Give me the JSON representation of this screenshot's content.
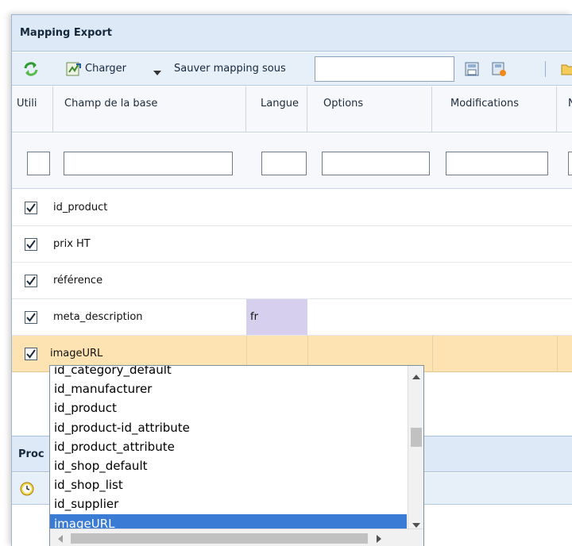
{
  "panel": {
    "title": "Mapping Export"
  },
  "toolbar": {
    "load_label": "Charger",
    "save_as_label": "Sauver mapping sous",
    "save_as_value": ""
  },
  "columns": [
    {
      "label": "Utili"
    },
    {
      "label": "Champ de la base"
    },
    {
      "label": "Langue"
    },
    {
      "label": "Options"
    },
    {
      "label": "Modifications"
    },
    {
      "label": "N"
    }
  ],
  "rows": [
    {
      "checked": true,
      "field": "id_product",
      "lang": ""
    },
    {
      "checked": true,
      "field": "prix HT",
      "lang": ""
    },
    {
      "checked": true,
      "field": "référence",
      "lang": ""
    },
    {
      "checked": true,
      "field": "meta_description",
      "lang": "fr"
    },
    {
      "checked": true,
      "field": "imageURL",
      "lang": "",
      "selected": true
    }
  ],
  "second_panel": {
    "title": "Proc"
  },
  "dropdown": {
    "items": [
      "id_category_default",
      "id_manufacturer",
      "id_product",
      "id_product-id_attribute",
      "id_product_attribute",
      "id_shop_default",
      "id_shop_list",
      "id_supplier",
      "imageURL"
    ],
    "selected": "imageURL"
  },
  "colors": {
    "selected_row": "#fde3b1",
    "lang_cell": "#d6d0ee",
    "dropdown_highlight": "#3a7bd5",
    "header_bg": "#dde9f7"
  },
  "icons": [
    "refresh-icon",
    "import-icon",
    "chevron-down-icon",
    "save-icon",
    "save-as-icon",
    "folder-icon",
    "clock-icon"
  ]
}
